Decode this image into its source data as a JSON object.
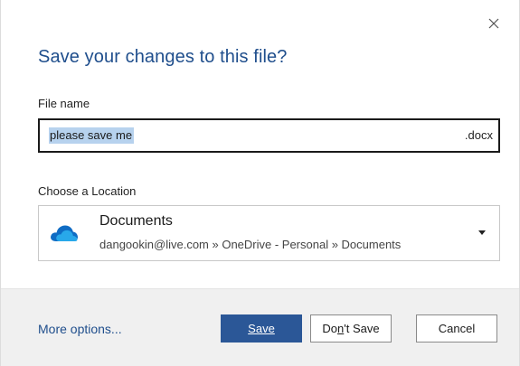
{
  "dialog": {
    "title": "Save your changes to this file?",
    "close_icon": "close-icon"
  },
  "file": {
    "label": "File name",
    "value": "please save me",
    "extension": ".docx"
  },
  "location": {
    "label": "Choose a Location",
    "icon": "onedrive-cloud-icon",
    "name": "Documents",
    "path": "dangookin@live.com » OneDrive - Personal » Documents",
    "caret_icon": "chevron-down-icon"
  },
  "footer": {
    "more_options": "More options...",
    "save_label": "Save",
    "dont_save_prefix": "Do",
    "dont_save_mnemonic": "n",
    "dont_save_suffix": "'t Save",
    "cancel_label": "Cancel"
  },
  "colors": {
    "accent": "#1f4e8c",
    "save_button": "#2b5797",
    "selection": "#b7d2ee",
    "footer_bg": "#f0f0f0"
  }
}
